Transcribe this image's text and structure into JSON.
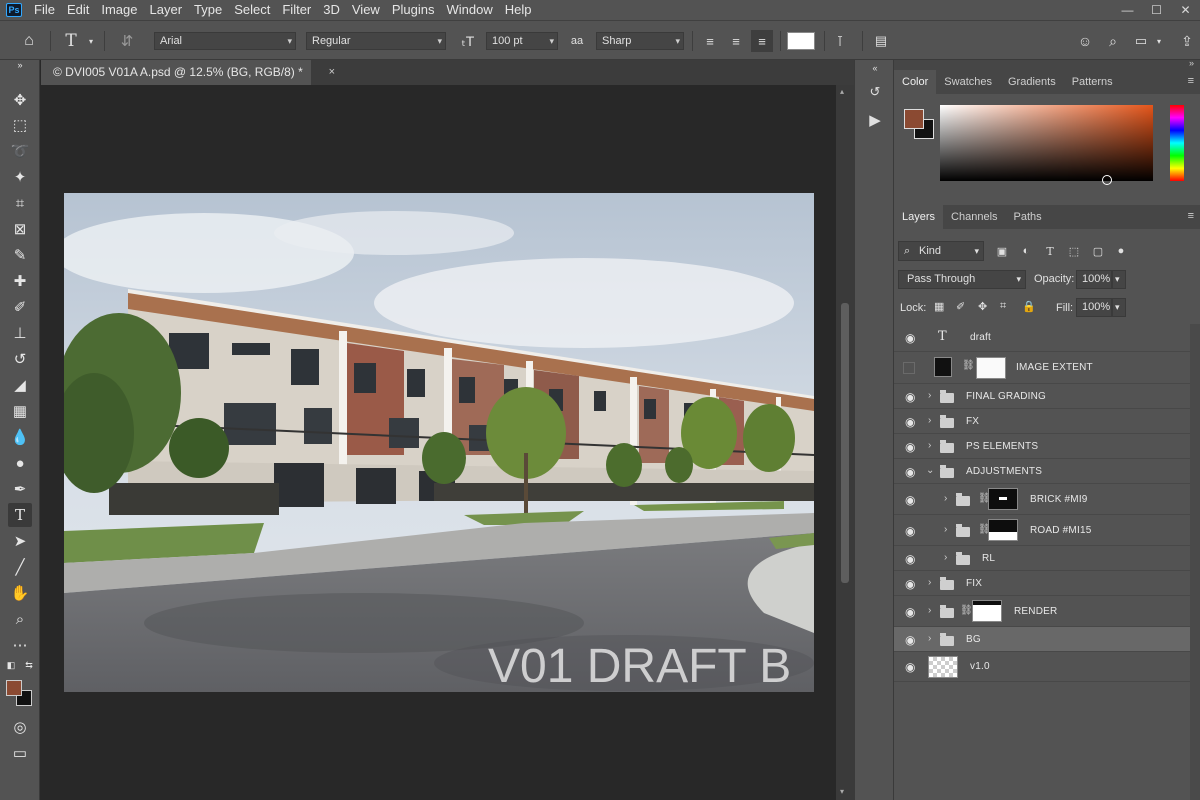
{
  "app": {
    "logo": "Ps"
  },
  "menu": [
    "File",
    "Edit",
    "Image",
    "Layer",
    "Type",
    "Select",
    "Filter",
    "3D",
    "View",
    "Plugins",
    "Window",
    "Help"
  ],
  "window_controls": {
    "minimize": "—",
    "maximize": "☐",
    "close": "✕"
  },
  "options_bar": {
    "font_family": "Arial",
    "font_style": "Regular",
    "font_size": "100 pt",
    "antialias_label": "aa",
    "antialias": "Sharp"
  },
  "document": {
    "tab_title": "© DVI005 V01A A.psd @ 12.5% (BG, RGB/8) *",
    "close_glyph": "×",
    "watermark": "V01 DRAFT B"
  },
  "color_panel": {
    "tabs": [
      "Color",
      "Swatches",
      "Gradients",
      "Patterns"
    ],
    "active_tab": "Color",
    "foreground": "#8b4a32",
    "background": "#111111"
  },
  "layers_panel": {
    "tabs": [
      "Layers",
      "Channels",
      "Paths"
    ],
    "active_tab": "Layers",
    "kind_filter": "Kind",
    "blend_mode": "Pass Through",
    "opacity_label": "Opacity:",
    "opacity": "100%",
    "lock_label": "Lock:",
    "fill_label": "Fill:",
    "fill": "100%",
    "layers": [
      {
        "name": "draft",
        "type": "text",
        "visible": true
      },
      {
        "name": "IMAGE EXTENT",
        "type": "masked",
        "visible": false
      },
      {
        "name": "FINAL GRADING",
        "type": "group",
        "visible": true
      },
      {
        "name": "FX",
        "type": "group",
        "visible": true
      },
      {
        "name": "PS ELEMENTS",
        "type": "group",
        "visible": true
      },
      {
        "name": "ADJUSTMENTS",
        "type": "group",
        "visible": true,
        "expanded": true
      },
      {
        "name": "BRICK #MI9",
        "type": "group-masked",
        "visible": true,
        "indent": 1
      },
      {
        "name": "ROAD #MI15",
        "type": "group-masked",
        "visible": true,
        "indent": 1
      },
      {
        "name": "RL",
        "type": "group",
        "visible": true,
        "indent": 1
      },
      {
        "name": "FIX",
        "type": "group",
        "visible": true
      },
      {
        "name": "RENDER",
        "type": "group-masked",
        "visible": true
      },
      {
        "name": "BG",
        "type": "group",
        "visible": true,
        "selected": true
      },
      {
        "name": "v1.0",
        "type": "pixel",
        "visible": true
      }
    ]
  }
}
